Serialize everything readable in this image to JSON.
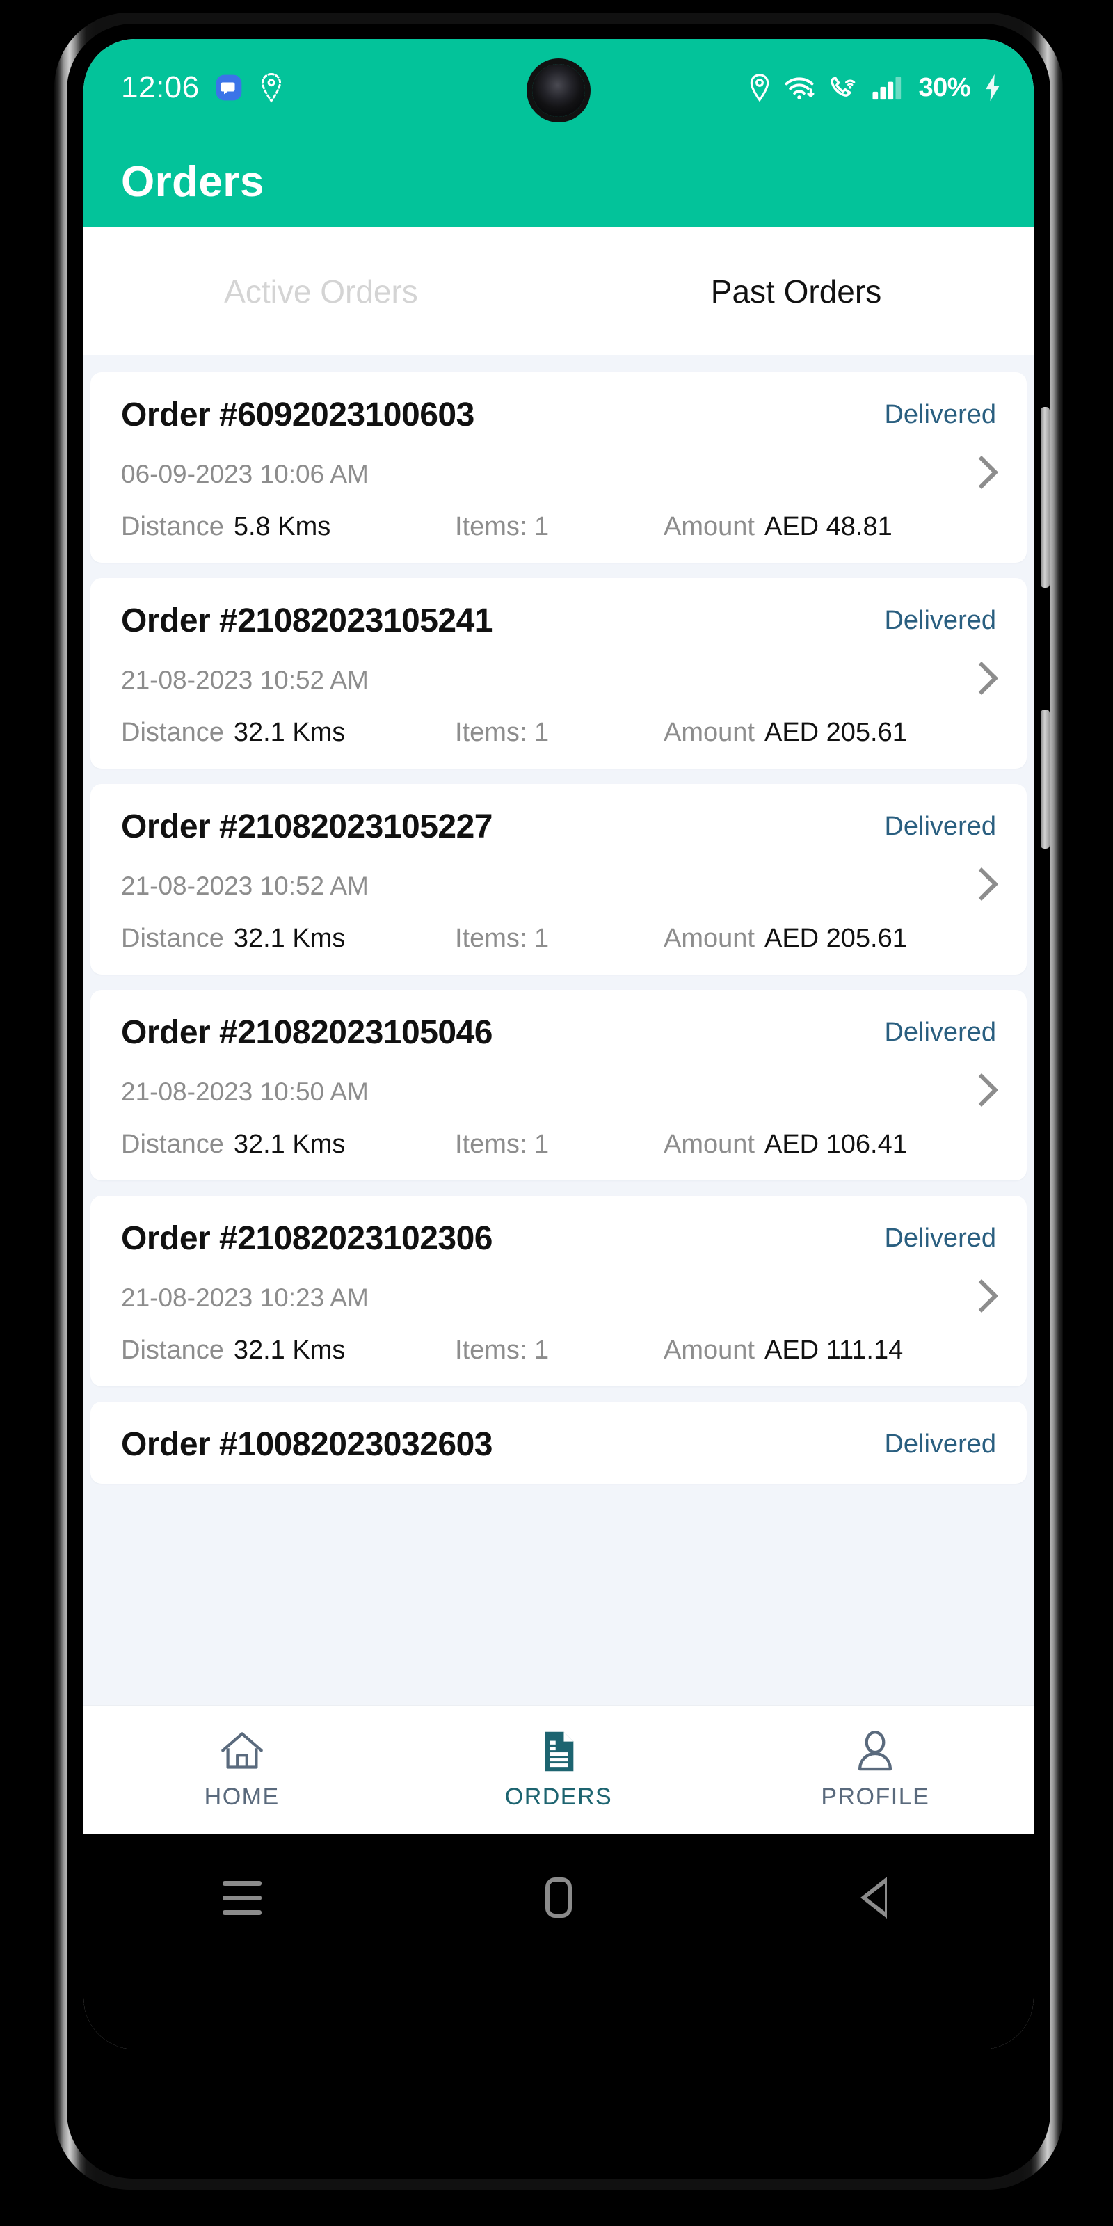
{
  "theme": {
    "brand_green": "#03C39A",
    "status_blue": "#2A5F80",
    "active_nav_teal": "#1d6470",
    "idle_nav_slate": "#5a6a7d",
    "page_bg": "#f2f5fa"
  },
  "statusbar": {
    "time": "12:06",
    "battery": "30%",
    "left_icons": [
      "chat-bubble-icon",
      "location-dotted-icon"
    ],
    "right_icons": [
      "location-pin-icon",
      "wifi-icon",
      "call-wifi-icon",
      "signal-bars-icon"
    ],
    "charging_icon": "charging-bolt-icon"
  },
  "appbar": {
    "title": "Orders"
  },
  "tabs": [
    {
      "label": "Active Orders",
      "active": false
    },
    {
      "label": "Past Orders",
      "active": true
    }
  ],
  "labels": {
    "distance": "Distance",
    "items": "Items: 1",
    "amount": "Amount"
  },
  "orders": [
    {
      "order_id": "Order #6092023100603",
      "status": "Delivered",
      "datetime": "06-09-2023 10:06 AM",
      "distance_label": "Distance",
      "distance": "5.8 Kms",
      "items": "Items: 1",
      "amount_label": "Amount",
      "amount": "AED 48.81"
    },
    {
      "order_id": "Order #21082023105241",
      "status": "Delivered",
      "datetime": "21-08-2023 10:52 AM",
      "distance_label": "Distance",
      "distance": "32.1 Kms",
      "items": "Items: 1",
      "amount_label": "Amount",
      "amount": "AED 205.61"
    },
    {
      "order_id": "Order #21082023105227",
      "status": "Delivered",
      "datetime": "21-08-2023 10:52 AM",
      "distance_label": "Distance",
      "distance": "32.1 Kms",
      "items": "Items: 1",
      "amount_label": "Amount",
      "amount": "AED 205.61"
    },
    {
      "order_id": "Order #21082023105046",
      "status": "Delivered",
      "datetime": "21-08-2023 10:50 AM",
      "distance_label": "Distance",
      "distance": "32.1 Kms",
      "items": "Items: 1",
      "amount_label": "Amount",
      "amount": "AED 106.41"
    },
    {
      "order_id": "Order #21082023102306",
      "status": "Delivered",
      "datetime": "21-08-2023 10:23 AM",
      "distance_label": "Distance",
      "distance": "32.1 Kms",
      "items": "Items: 1",
      "amount_label": "Amount",
      "amount": "AED 111.14"
    },
    {
      "order_id": "Order #10082023032603",
      "status": "Delivered",
      "datetime": "",
      "distance_label": "",
      "distance": "",
      "items": "",
      "amount_label": "",
      "amount": ""
    }
  ],
  "bottom_nav": [
    {
      "label": "HOME",
      "icon": "home-icon",
      "active": false
    },
    {
      "label": "ORDERS",
      "icon": "document-icon",
      "active": true
    },
    {
      "label": "PROFILE",
      "icon": "person-icon",
      "active": false
    }
  ],
  "system_nav": [
    {
      "name": "recents-button"
    },
    {
      "name": "home-button"
    },
    {
      "name": "back-button"
    }
  ]
}
